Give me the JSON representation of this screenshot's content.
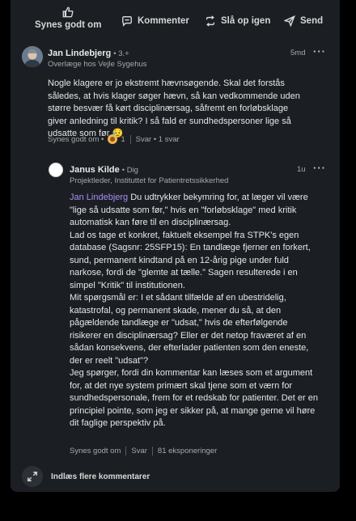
{
  "actions": {
    "like": "Synes godt om",
    "comment": "Kommenter",
    "repost": "Slå op igen",
    "send": "Send"
  },
  "comment1": {
    "author": "Jan Lindebjerg",
    "degree": "• 3.+",
    "headline": "Overlæge hos Vejle Sygehus",
    "time": "5md",
    "text": "Nogle klagere er jo ekstremt hævnsøgende. Skal det forstås således, at hvis klager søger hævn, så kan vedkommende uden større besvær få kørt disciplinærsag, såfremt en forløbsklage giver anledning til kritik? I så fald er sundhedspersoner lige så udsatte som før 😥",
    "like_label": "Synes godt om •",
    "reaction_count": "1",
    "reply_label": "Svar • 1 svar"
  },
  "reply": {
    "author": "Janus Kilde",
    "degree": "• Dig",
    "headline": "Projektleder, Instituttet for Patientretssikkerhed",
    "time": "1u",
    "mention": "Jan Lindebjerg",
    "p1": " Du udtrykker bekymring for, at læger vil være \"lige så udsatte som før,\" hvis en \"forløbsklage\" med kritik automatisk kan føre til en disciplinærsag.",
    "p2": "Lad os tage et konkret, faktuelt eksempel fra STPK's egen database (Sagsnr: 25SFP15): En tandlæge fjerner en forkert, sund, permanent kindtand på en 12-årig pige under fuld narkose, fordi de \"glemte at tælle.\" Sagen resulterede i en simpel \"Kritik\" til institutionen.",
    "p3": "Mit spørgsmål er: I et sådant tilfælde af en ubestridelig, katastrofal, og permanent skade, mener du så, at den pågældende tandlæge er \"udsat,\" hvis de efterfølgende risikerer en disciplinærsag? Eller er det netop fraværet af en sådan konsekvens, der efterlader patienten som den eneste, der er reelt \"udsat\"?",
    "p4": "Jeg spørger, fordi din kommentar kan læses som et argument for, at det nye system primært skal tjene som et værn for sundhedspersonale, frem for et redskab for patienter. Det er en principiel pointe, som jeg er sikker på, at mange gerne vil høre dit faglige perspektiv på.",
    "like_label": "Synes godt om",
    "reply_label": "Svar",
    "impressions": "81 eksponeringer"
  },
  "load_more": "Indlæs flere kommentarer"
}
